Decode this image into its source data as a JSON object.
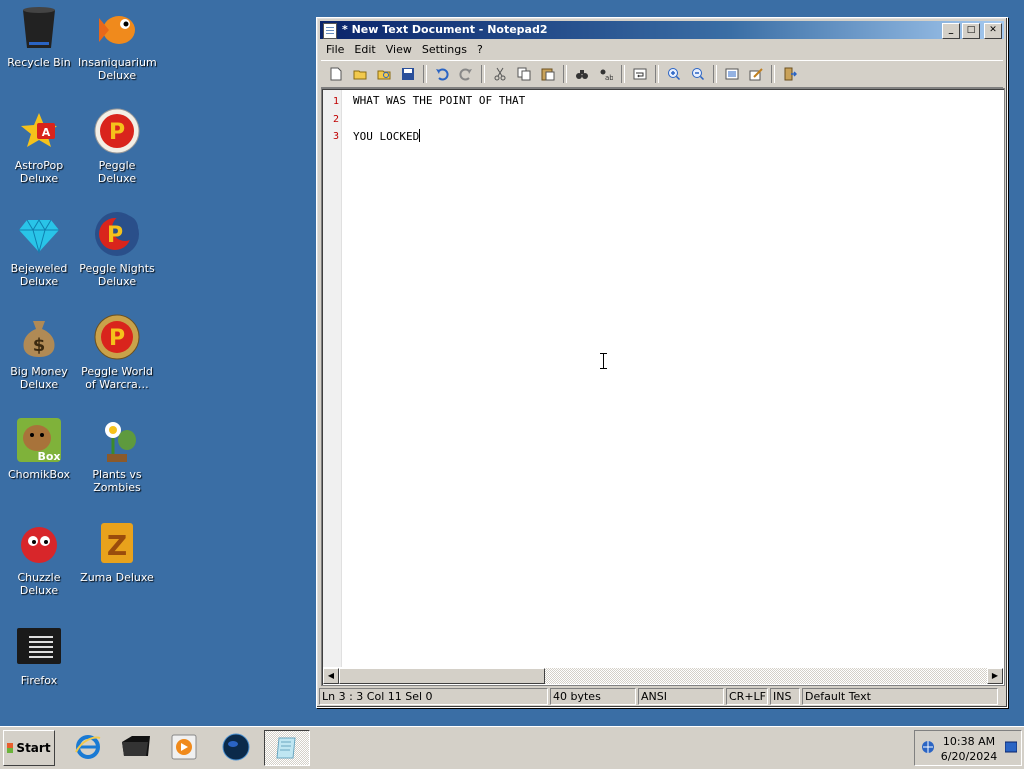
{
  "desktop": {
    "icons": [
      {
        "label": "Recycle Bin",
        "icon": "recycle-bin-icon"
      },
      {
        "label": "Insaniquarium Deluxe",
        "icon": "goldfish-icon"
      },
      {
        "label": "AstroPop Deluxe",
        "icon": "astropop-icon"
      },
      {
        "label": "Peggle Deluxe",
        "icon": "peggle-icon"
      },
      {
        "label": "Bejeweled Deluxe",
        "icon": "gem-icon"
      },
      {
        "label": "Peggle Nights Deluxe",
        "icon": "peggle-nights-icon"
      },
      {
        "label": "Big Money Deluxe",
        "icon": "money-bag-icon"
      },
      {
        "label": "Peggle World of Warcra…",
        "icon": "peggle-wow-icon"
      },
      {
        "label": "ChomikBox",
        "icon": "chomikbox-icon"
      },
      {
        "label": "Plants vs Zombies",
        "icon": "plants-vs-zombies-icon"
      },
      {
        "label": "Chuzzle Deluxe",
        "icon": "chuzzle-icon"
      },
      {
        "label": "Zuma Deluxe",
        "icon": "zuma-icon"
      },
      {
        "label": "Firefox",
        "icon": "firefox-icon"
      }
    ]
  },
  "window": {
    "title": "* New Text Document - Notepad2",
    "buttons": {
      "minimize": "_",
      "maximize": "□",
      "close": "✕"
    },
    "menu": [
      "File",
      "Edit",
      "View",
      "Settings",
      "?"
    ],
    "toolbar": [
      "new-icon",
      "open-icon",
      "browse-icon",
      "save-icon",
      "undo-icon",
      "redo-icon",
      "cut-icon",
      "copy-icon",
      "paste-icon",
      "find-icon",
      "replace-icon",
      "word-wrap-icon",
      "zoom-in-icon",
      "zoom-out-icon",
      "scheme-icon",
      "customize-scheme-icon",
      "exit-icon"
    ],
    "editor": {
      "lines": [
        {
          "num": "1",
          "text": "WHAT WAS THE POINT OF THAT"
        },
        {
          "num": "2",
          "text": ""
        },
        {
          "num": "3",
          "text": "YOU LOCKED"
        }
      ]
    },
    "status": {
      "position": "Ln 3 : 3   Col 11   Sel 0",
      "size": "40 bytes",
      "encoding": "ANSI",
      "line_endings": "CR+LF",
      "mode": "INS",
      "scheme": "Default Text"
    }
  },
  "taskbar": {
    "start_label": "Start",
    "time": "10:38 AM",
    "date": "6/20/2024"
  }
}
